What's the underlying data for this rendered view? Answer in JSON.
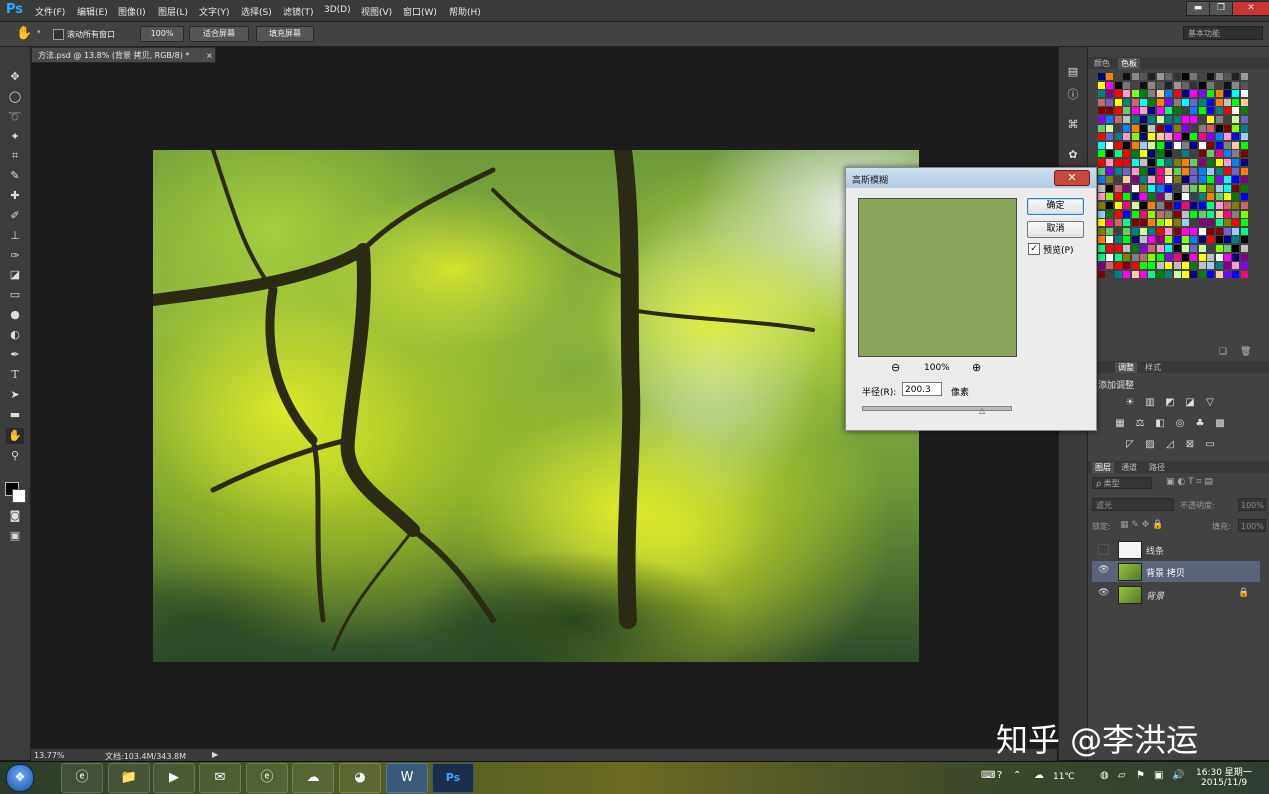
{
  "app": {
    "logo": "Ps"
  },
  "menu": [
    "文件(F)",
    "编辑(E)",
    "图像(I)",
    "图层(L)",
    "文字(Y)",
    "选择(S)",
    "滤镜(T)",
    "3D(D)",
    "视图(V)",
    "窗口(W)",
    "帮助(H)"
  ],
  "window_controls": {
    "minimize": "▬",
    "restore": "❐",
    "close": "✕"
  },
  "options": {
    "scroll_all_label": "滚动所有窗口",
    "zoom_value": "100%",
    "fit_screen": "适合屏幕",
    "fill_screen": "填充屏幕",
    "workspace": "基本功能"
  },
  "document": {
    "tab_title": "方法.psd @ 13.8% (背景 拷贝, RGB/8) *",
    "tab_close": "×"
  },
  "status": {
    "zoom": "13.77%",
    "doc_size": "文档:103.4M/343.8M"
  },
  "color_panel": {
    "tab_color": "颜色",
    "tab_swatches": "色板"
  },
  "adjust_panel": {
    "tab_adjust": "调整",
    "tab_styles": "样式",
    "add_adjust": "添加调整"
  },
  "layers_panel": {
    "tab_layers": "图层",
    "tab_channels": "通道",
    "tab_paths": "路径",
    "filter_kind": "ρ 类型",
    "blend_mode": "滤光",
    "opacity_label": "不透明度:",
    "opacity_value": "100%",
    "lock_label": "锁定:",
    "fill_label": "填充:",
    "fill_value": "100%",
    "layers": [
      {
        "name": "线条",
        "visible": false
      },
      {
        "name": "背景 拷贝",
        "visible": true,
        "selected": true
      },
      {
        "name": "背景",
        "visible": true,
        "locked": true
      }
    ]
  },
  "dialog": {
    "title": "高斯模糊",
    "close": "✕",
    "ok": "确定",
    "cancel": "取消",
    "preview_label": "预览(P)",
    "preview_checked": "✓",
    "zoom_level": "100%",
    "radius_label": "半径(R):",
    "radius_value": "200.3",
    "radius_unit": "像素",
    "preview_color": "#8ba45e"
  },
  "watermark": "知乎 @李洪运",
  "taskbar": {
    "temp": "11℃",
    "time": "16:30 星期一",
    "date": "2015/11/9"
  }
}
